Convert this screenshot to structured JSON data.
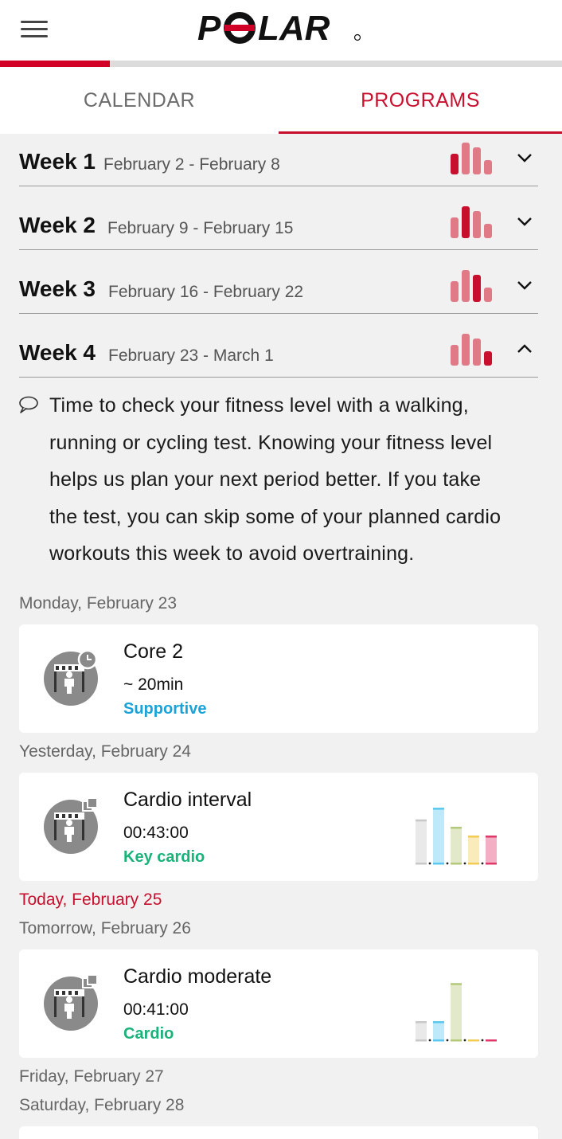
{
  "header": {
    "brand_logo": "POLAR",
    "menu_icon": "hamburger-menu-icon",
    "progress_fraction": 0.195
  },
  "tabs": [
    {
      "label": "CALENDAR",
      "selected": false
    },
    {
      "label": "PROGRAMS",
      "selected": true
    }
  ],
  "weeks": [
    {
      "title": "Week 1",
      "dates": "February 2 - February 8",
      "highlight_bar": 0,
      "expanded": false
    },
    {
      "title": "Week 2",
      "dates": "February 9 - February 15",
      "highlight_bar": 1,
      "expanded": false
    },
    {
      "title": "Week 3",
      "dates": "February 16 - February 22",
      "highlight_bar": 2,
      "expanded": false
    },
    {
      "title": "Week 4",
      "dates": "February 23 - March 1",
      "highlight_bar": 3,
      "expanded": true
    }
  ],
  "week_tip": {
    "icon": "speech-bubble-icon",
    "lines": [
      "Time to check your fitness level with a walking,",
      "running or cycling test. Knowing your fitness level",
      "helps us plan your next period better. If you take",
      "the test, you can skip some of your planned cardio",
      "workouts this week to avoid overtraining."
    ]
  },
  "days": [
    {
      "label": "Monday, February 23",
      "today": false
    },
    {
      "label": "Yesterday, February 24",
      "today": false
    },
    {
      "label": "Today, February 25",
      "today": true
    },
    {
      "label": "Tomorrow, February 26",
      "today": false
    },
    {
      "label": "Friday, February 27",
      "today": false
    },
    {
      "label": "Saturday, February 28",
      "today": false
    }
  ],
  "workouts": [
    {
      "name": "Core 2",
      "duration": "~ 20min",
      "type": "Supportive",
      "type_color": "#1aa3d9",
      "icon": "timed-exercise-icon",
      "zones": null
    },
    {
      "name": "Cardio interval",
      "duration": "00:43:00",
      "type": "Key cardio",
      "type_color": "#19b37a",
      "icon": "multi-exercise-icon",
      "zones": [
        0.6,
        0.76,
        0.5,
        0.38,
        0.38
      ]
    },
    {
      "name": "Cardio moderate",
      "duration": "00:41:00",
      "type": "Cardio",
      "type_color": "#19b37a",
      "icon": "multi-exercise-icon",
      "zones": [
        0.26,
        0.26,
        0.78,
        0.0,
        0.0
      ]
    }
  ],
  "colors": {
    "brand_red": "#d10027",
    "week_bar_light": "#e07a86",
    "week_bar_strong": "#c8102e",
    "zone_colors": [
      "#c8c8c8",
      "#5cc8ee",
      "#b5c97a",
      "#f2cc55",
      "#e0386a"
    ]
  }
}
